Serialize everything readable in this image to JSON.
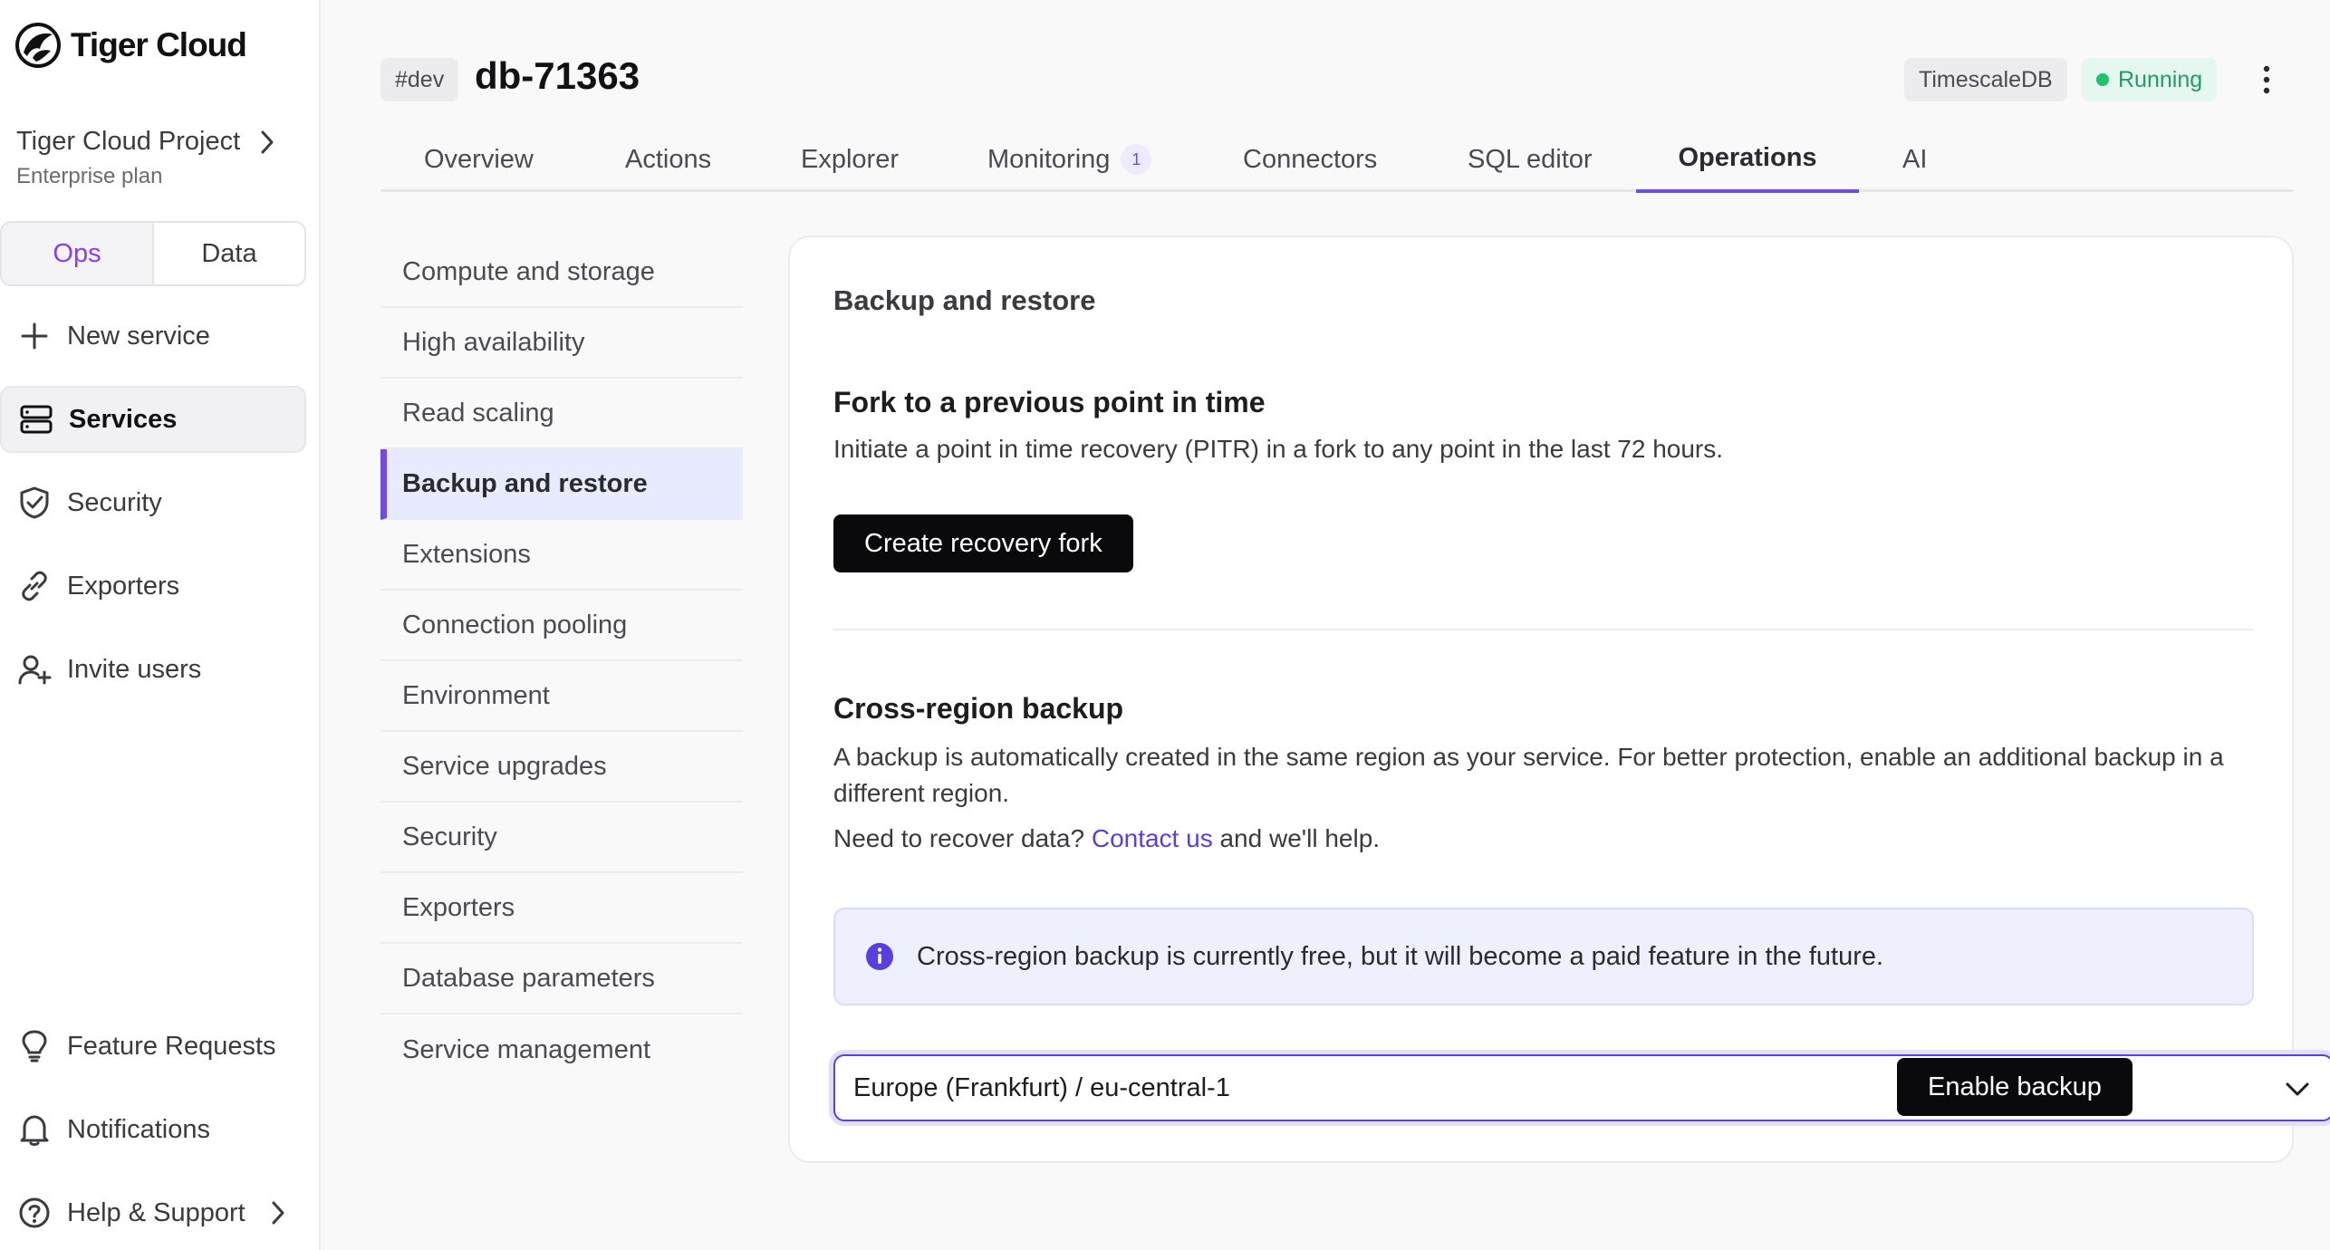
{
  "brand": {
    "name": "Tiger Cloud"
  },
  "project": {
    "name": "Tiger Cloud Project",
    "plan": "Enterprise plan"
  },
  "mode_toggle": {
    "ops": "Ops",
    "data": "Data",
    "active": "Ops"
  },
  "sidebar": {
    "items": [
      {
        "label": "New service",
        "icon": "plus-icon"
      },
      {
        "label": "Services",
        "icon": "services-icon",
        "active": true
      },
      {
        "label": "Security",
        "icon": "shield-check-icon"
      },
      {
        "label": "Exporters",
        "icon": "link-icon"
      },
      {
        "label": "Invite users",
        "icon": "user-plus-icon"
      }
    ],
    "bottom": [
      {
        "label": "Feature Requests",
        "icon": "lightbulb-icon"
      },
      {
        "label": "Notifications",
        "icon": "bell-icon"
      },
      {
        "label": "Help & Support",
        "icon": "help-circle-icon"
      }
    ]
  },
  "header": {
    "env": "#dev",
    "service_name": "db-71363",
    "engine": "TimescaleDB",
    "status": "Running",
    "status_color": "#1fbf74"
  },
  "tabs": [
    {
      "label": "Overview"
    },
    {
      "label": "Actions"
    },
    {
      "label": "Explorer"
    },
    {
      "label": "Monitoring",
      "count": "1"
    },
    {
      "label": "Connectors"
    },
    {
      "label": "SQL editor"
    },
    {
      "label": "Operations",
      "active": true
    },
    {
      "label": "AI"
    }
  ],
  "subnav": [
    "Compute and storage",
    "High availability",
    "Read scaling",
    "Backup and restore",
    "Extensions",
    "Connection pooling",
    "Environment",
    "Service upgrades",
    "Security",
    "Exporters",
    "Database parameters",
    "Service management"
  ],
  "subnav_active": "Backup and restore",
  "card": {
    "title": "Backup and restore",
    "fork": {
      "title": "Fork to a previous point in time",
      "description": "Initiate a point in time recovery (PITR) in a fork to any point in the last 72 hours.",
      "button": "Create recovery fork"
    },
    "cross_region": {
      "title": "Cross-region backup",
      "description": "A backup is automatically created in the same region as your service. For better protection, enable an additional backup in a different region.",
      "recover_prefix": "Need to recover data?",
      "recover_link": "Contact us",
      "recover_suffix": "and we'll help.",
      "info": "Cross-region backup is currently free, but it will become a paid feature in the future.",
      "region_value": "Europe (Frankfurt) / eu-central-1",
      "enable_button": "Enable backup"
    }
  },
  "colors": {
    "accent": "#6b4de6",
    "link": "#5b3ee0",
    "toggle_active": "#8b3cf0",
    "info_bg": "#eef0fe"
  }
}
